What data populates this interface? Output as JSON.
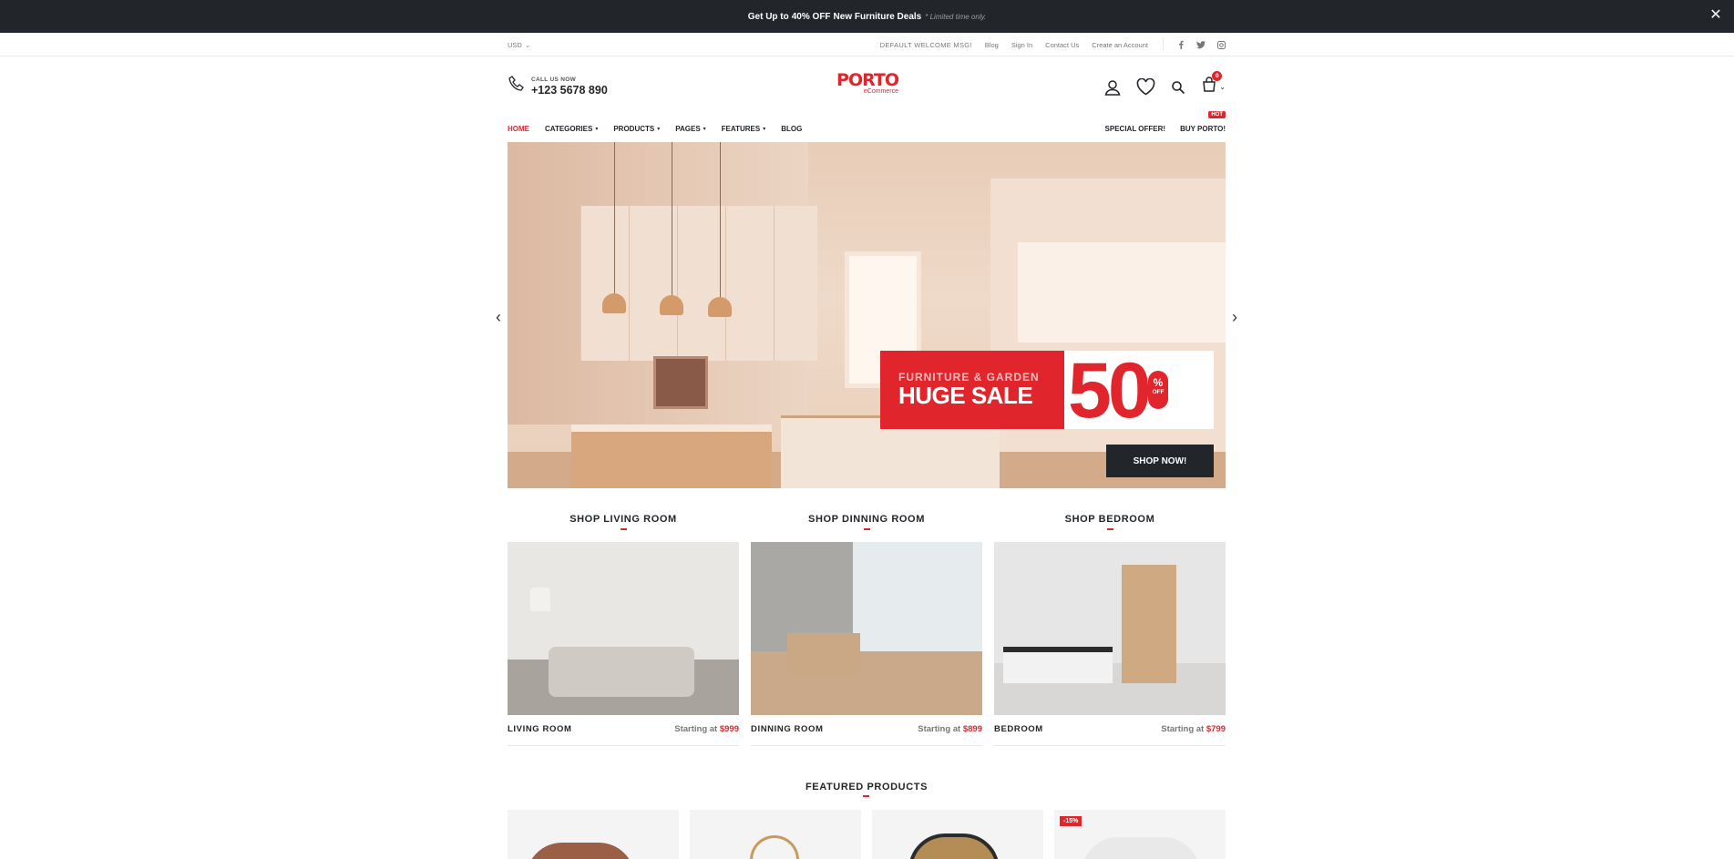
{
  "promo": {
    "prefix": "Get Up to",
    "highlight": "40% OFF",
    "suffix": "New Furniture Deals",
    "note": "* Limited time only."
  },
  "topbar": {
    "currency": "USD",
    "welcome": "DEFAULT WELCOME MSG!",
    "links": [
      "Blog",
      "Sign In",
      "Contact Us",
      "Create an Account"
    ],
    "social_icons": [
      "facebook-icon",
      "twitter-icon",
      "instagram-icon"
    ]
  },
  "header": {
    "call_label": "CALL US NOW",
    "phone": "+123 5678 890",
    "logo_word": "PORTO",
    "logo_sub": "eCommerce",
    "cart_count": "0",
    "icons": [
      "user-icon",
      "heart-icon",
      "search-icon",
      "cart-icon"
    ]
  },
  "nav": {
    "items": [
      "HOME",
      "CATEGORIES",
      "PRODUCTS",
      "PAGES",
      "FEATURES",
      "BLOG"
    ],
    "right": [
      "SPECIAL OFFER!",
      "BUY PORTO!"
    ],
    "hot_badge": "HOT"
  },
  "hero": {
    "kicker": "FURNITURE & GARDEN",
    "headline": "HUGE SALE",
    "number": "50",
    "percent": "%",
    "off": "OFF",
    "cta": "SHOP NOW!"
  },
  "categories": [
    {
      "title": "SHOP LIVING ROOM",
      "name": "LIVING ROOM",
      "starting": "Starting at",
      "price": "$999"
    },
    {
      "title": "SHOP DINNING ROOM",
      "name": "DINNING ROOM",
      "starting": "Starting at",
      "price": "$899"
    },
    {
      "title": "SHOP BEDROOM",
      "name": "BEDROOM",
      "starting": "Starting at",
      "price": "$799"
    }
  ],
  "featured": {
    "title": "FEATURED PRODUCTS",
    "discount": "-15%"
  },
  "colors": {
    "accent": "#e0262c",
    "dark": "#222529"
  }
}
